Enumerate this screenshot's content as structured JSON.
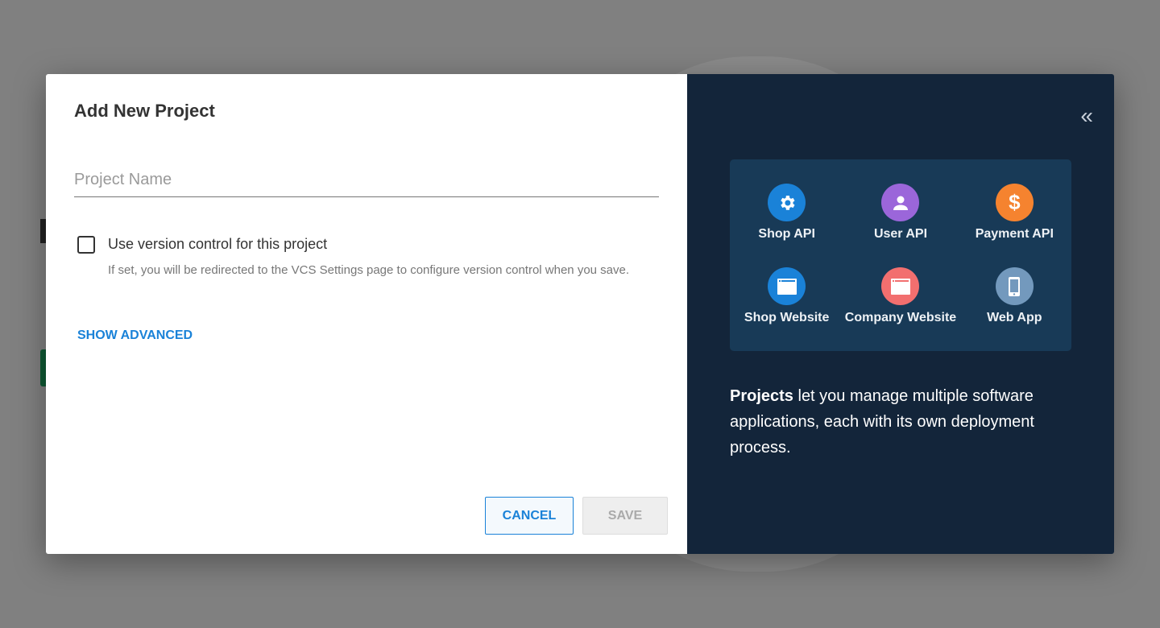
{
  "dialog": {
    "title": "Add New Project",
    "project_name_placeholder": "Project Name",
    "project_name_value": "",
    "vcs_checkbox_label": "Use version control for this project",
    "vcs_checked": false,
    "vcs_help": "If set, you will be redirected to the VCS Settings page to configure version control when you save.",
    "show_advanced": "SHOW ADVANCED",
    "cancel": "CANCEL",
    "save": "SAVE"
  },
  "panel": {
    "collapse_icon": "double-chevron-left-icon",
    "project_types": [
      {
        "label": "Shop API",
        "icon": "gear-icon",
        "color": "#1a82d8"
      },
      {
        "label": "User API",
        "icon": "user-icon",
        "color": "#9b66da"
      },
      {
        "label": "Payment API",
        "icon": "dollar-icon",
        "color": "#f5832f"
      },
      {
        "label": "Shop Website",
        "icon": "browser-window-icon",
        "color": "#1a82d8"
      },
      {
        "label": "Company Website",
        "icon": "browser-window-icon",
        "color": "#f26f6f"
      },
      {
        "label": "Web App",
        "icon": "mobile-phone-icon",
        "color": "#7399bd"
      }
    ],
    "description_bold": "Projects",
    "description_rest": " let you manage multiple software applications, each with its own deployment process."
  }
}
